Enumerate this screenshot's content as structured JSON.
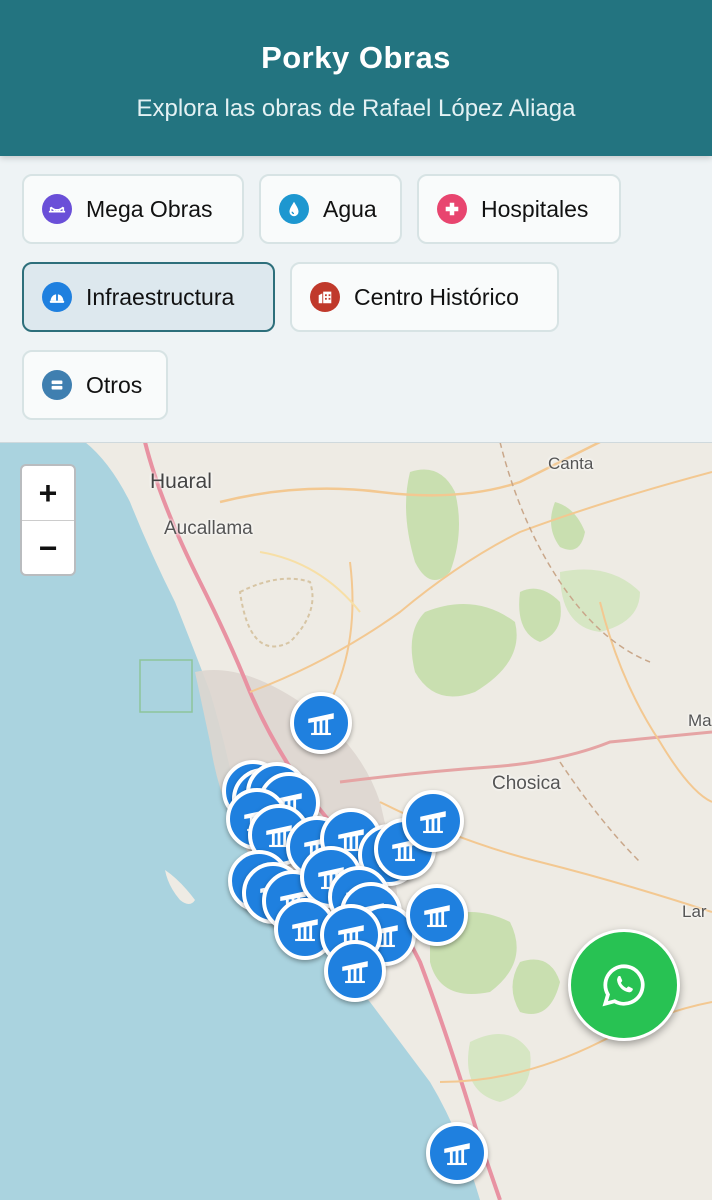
{
  "header": {
    "title": "Porky Obras",
    "subtitle": "Explora las obras de Rafael López Aliaga"
  },
  "filters": [
    {
      "label": "Mega Obras",
      "icon": "bridge-icon",
      "color": "#6a4fd8",
      "active": false
    },
    {
      "label": "Agua",
      "icon": "water-drop-icon",
      "color": "#1d97d0",
      "active": false
    },
    {
      "label": "Hospitales",
      "icon": "medical-cross-icon",
      "color": "#e8456f",
      "active": false
    },
    {
      "label": "Infraestructura",
      "icon": "hard-hat-icon",
      "color": "#1f80df",
      "active": true
    },
    {
      "label": "Centro Histórico",
      "icon": "building-icon",
      "color": "#c0392b",
      "active": false
    },
    {
      "label": "Otros",
      "icon": "list-icon",
      "color": "#3f7fb0",
      "active": false
    }
  ],
  "map": {
    "places": [
      "Huaral",
      "Aucallama",
      "Canta",
      "Chosica",
      "Ma",
      "Lar"
    ],
    "zoom_in": "+",
    "zoom_out": "−",
    "marker_icon": "road-works-icon",
    "marker_color": "#1f80df",
    "marker_count": 20
  },
  "whatsapp": {
    "icon": "whatsapp-icon",
    "color": "#28c253"
  }
}
